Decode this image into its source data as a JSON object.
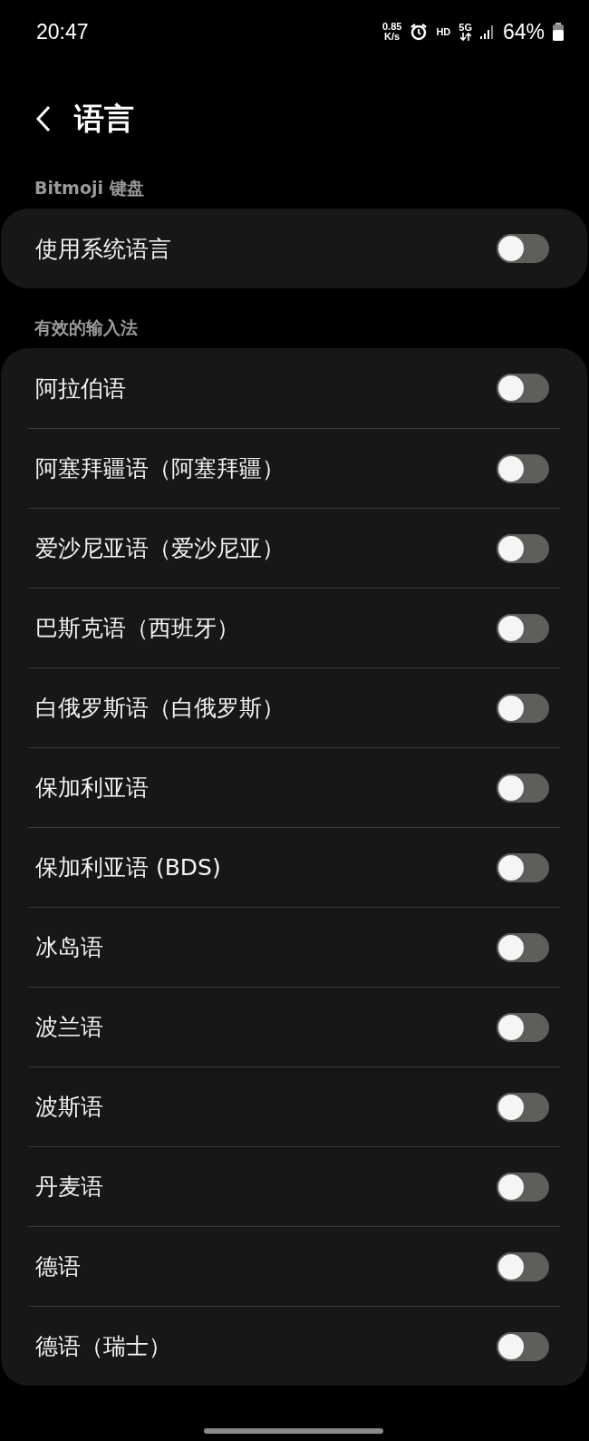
{
  "status_bar": {
    "time": "20:47",
    "net_speed": "0.85",
    "net_unit": "K/s",
    "hd": "HD",
    "network": "5G",
    "battery": "64%"
  },
  "header": {
    "title": "语言"
  },
  "sections": [
    {
      "title": "Bitmoji 键盘",
      "items": [
        {
          "label": "使用系统语言",
          "on": false
        }
      ]
    },
    {
      "title": "有效的输入法",
      "items": [
        {
          "label": "阿拉伯语",
          "on": false
        },
        {
          "label": "阿塞拜疆语（阿塞拜疆）",
          "on": false
        },
        {
          "label": "爱沙尼亚语（爱沙尼亚）",
          "on": false
        },
        {
          "label": "巴斯克语（西班牙）",
          "on": false
        },
        {
          "label": "白俄罗斯语（白俄罗斯）",
          "on": false
        },
        {
          "label": "保加利亚语",
          "on": false
        },
        {
          "label": "保加利亚语 (BDS)",
          "on": false
        },
        {
          "label": "冰岛语",
          "on": false
        },
        {
          "label": "波兰语",
          "on": false
        },
        {
          "label": "波斯语",
          "on": false
        },
        {
          "label": "丹麦语",
          "on": false
        },
        {
          "label": "德语",
          "on": false
        },
        {
          "label": "德语（瑞士）",
          "on": false
        }
      ]
    }
  ]
}
